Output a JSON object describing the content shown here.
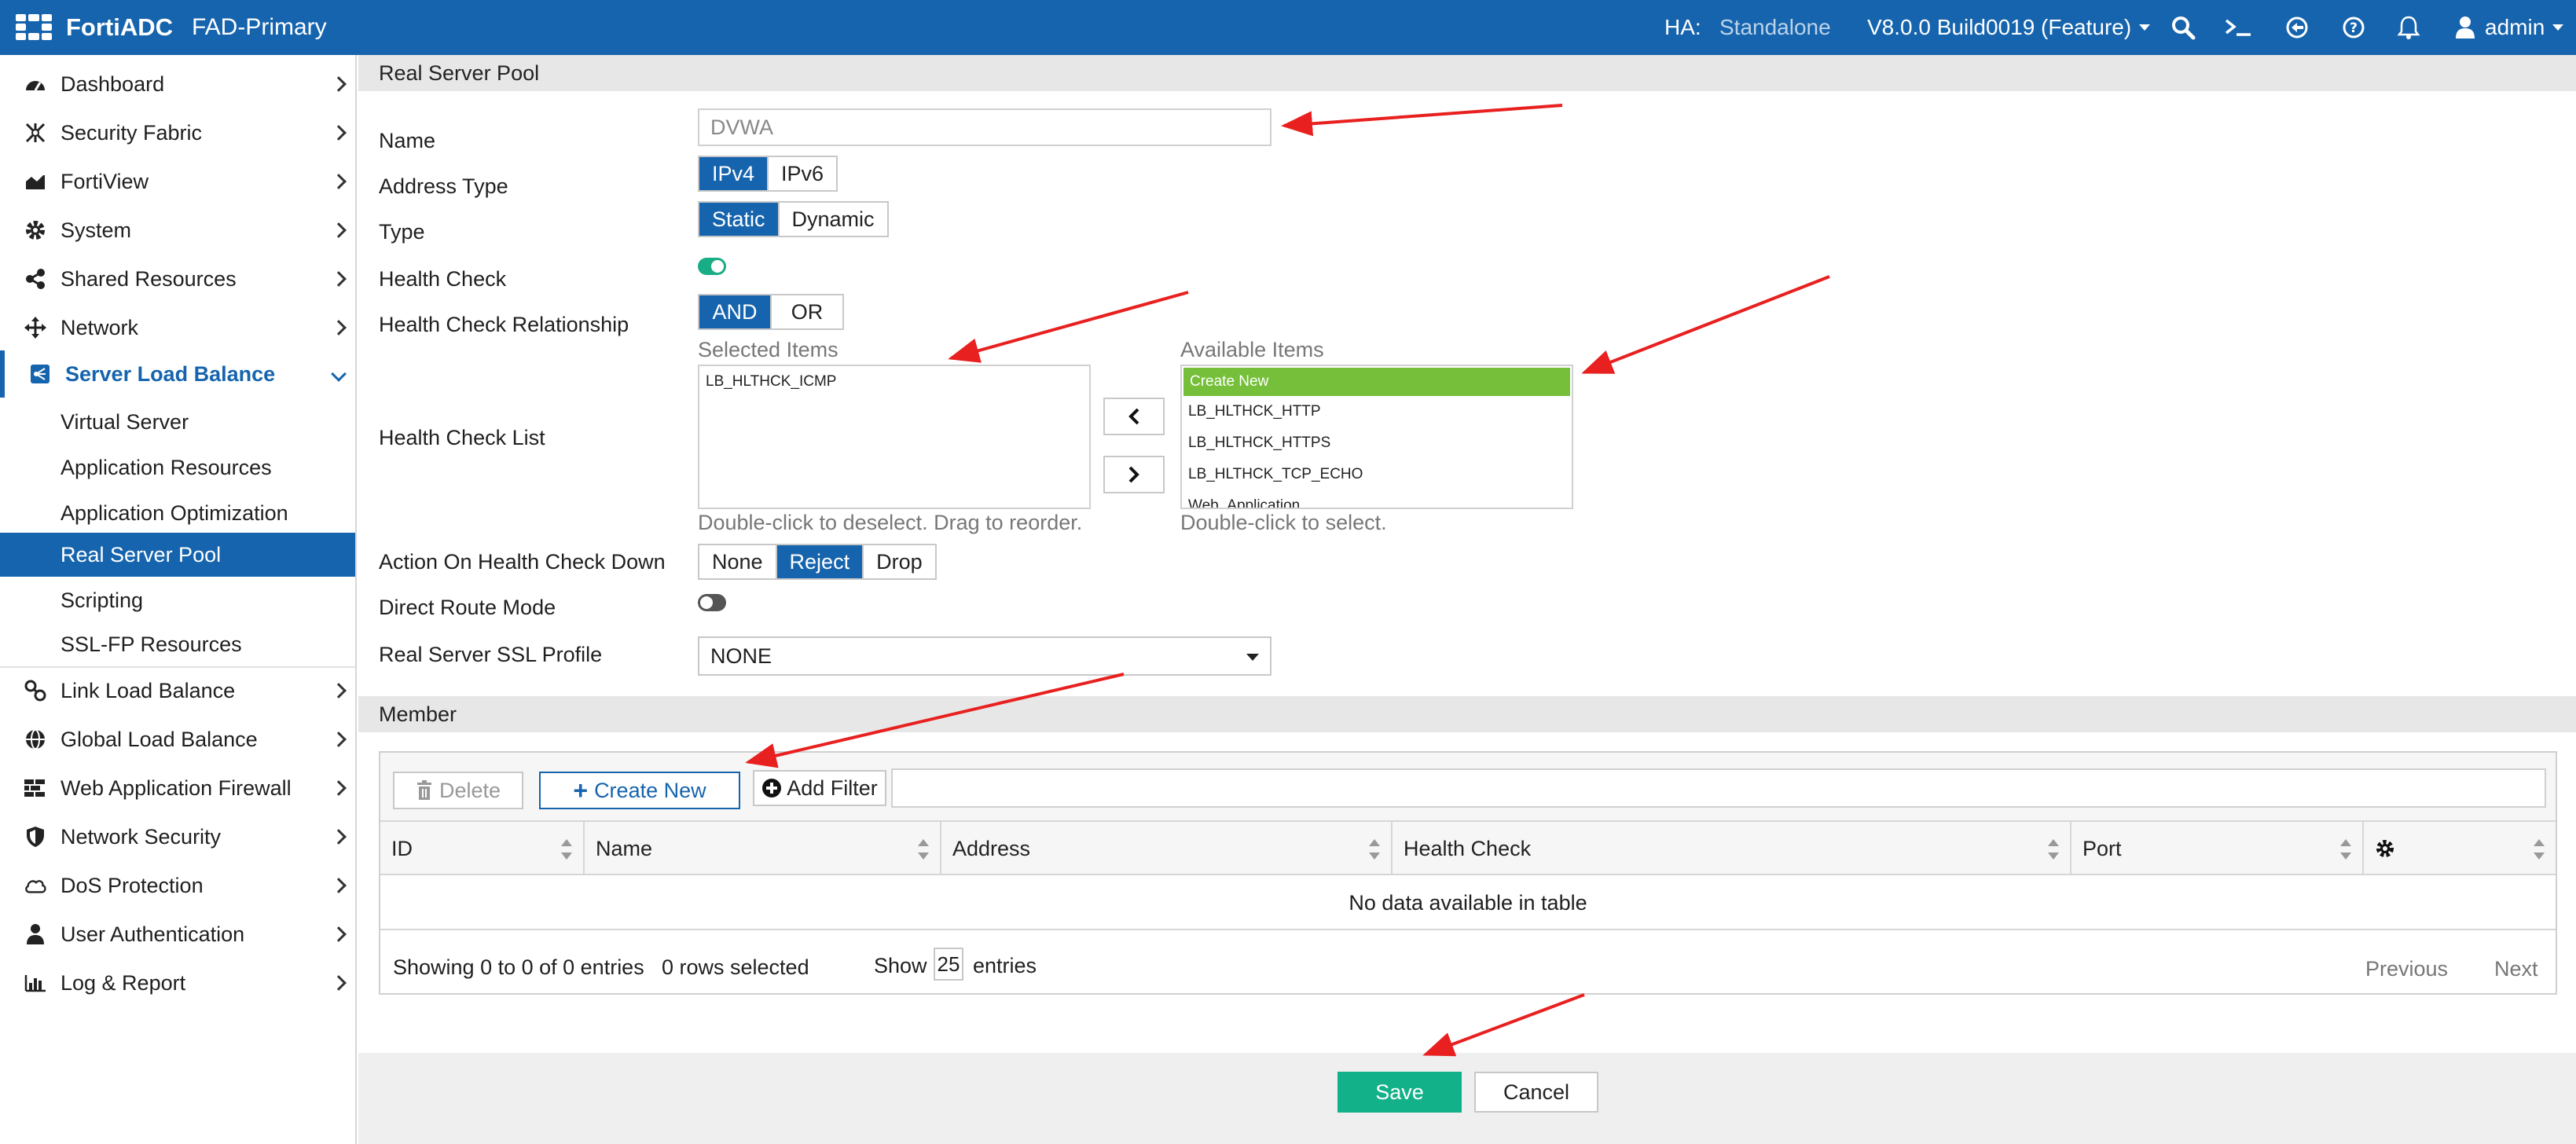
{
  "topbar": {
    "brand": "FortiADC",
    "hostname": "FAD-Primary",
    "ha_label": "HA:",
    "ha_value": "Standalone",
    "version": "V8.0.0 Build0019 (Feature)",
    "user": "admin",
    "icons": [
      "grid-icon",
      "search-icon",
      "terminal-icon",
      "refresh-icon",
      "help-icon",
      "bell-icon",
      "user-icon"
    ]
  },
  "sidebar": {
    "items": [
      {
        "label": "Dashboard",
        "icon": "dashboard-icon"
      },
      {
        "label": "Security Fabric",
        "icon": "fabric-icon"
      },
      {
        "label": "FortiView",
        "icon": "chart-icon"
      },
      {
        "label": "System",
        "icon": "gear-icon"
      },
      {
        "label": "Shared Resources",
        "icon": "share-icon"
      },
      {
        "label": "Network",
        "icon": "move-icon"
      },
      {
        "label": "Server Load Balance",
        "icon": "slb-icon"
      },
      {
        "label": "Link Load Balance",
        "icon": "link-icon"
      },
      {
        "label": "Global Load Balance",
        "icon": "globe-icon"
      },
      {
        "label": "Web Application Firewall",
        "icon": "firewall-icon"
      },
      {
        "label": "Network Security",
        "icon": "shield-icon"
      },
      {
        "label": "DoS Protection",
        "icon": "cloud-icon"
      },
      {
        "label": "User Authentication",
        "icon": "user-icon"
      },
      {
        "label": "Log & Report",
        "icon": "bar-chart-icon"
      }
    ],
    "subitems": [
      {
        "label": "Virtual Server"
      },
      {
        "label": "Application Resources"
      },
      {
        "label": "Application Optimization"
      },
      {
        "label": "Real Server Pool"
      },
      {
        "label": "Scripting"
      },
      {
        "label": "SSL-FP Resources"
      }
    ]
  },
  "form": {
    "section_title": "Real Server Pool",
    "name_label": "Name",
    "name_value": "DVWA",
    "address_type_label": "Address Type",
    "address_type_options": [
      "IPv4",
      "IPv6"
    ],
    "type_label": "Type",
    "type_options": [
      "Static",
      "Dynamic"
    ],
    "health_check_label": "Health Check",
    "relationship_label": "Health Check Relationship",
    "relationship_options": [
      "AND",
      "OR"
    ],
    "list_label": "Health Check List",
    "selected_caption": "Selected Items",
    "available_caption": "Available Items",
    "selected_items": [
      "LB_HLTHCK_ICMP"
    ],
    "available_items": [
      "Create New",
      "LB_HLTHCK_HTTP",
      "LB_HLTHCK_HTTPS",
      "LB_HLTHCK_TCP_ECHO",
      "Web_Application"
    ],
    "selected_hint": "Double-click to deselect. Drag to reorder.",
    "available_hint": "Double-click to select.",
    "action_label": "Action On Health Check Down",
    "action_options": [
      "None",
      "Reject",
      "Drop"
    ],
    "direct_route_label": "Direct Route Mode",
    "ssl_label": "Real Server SSL Profile",
    "ssl_value": "NONE"
  },
  "member": {
    "section_title": "Member",
    "delete_label": "Delete",
    "create_label": "Create New",
    "filter_label": "Add Filter",
    "columns": [
      "ID",
      "Name",
      "Address",
      "Health Check",
      "Port"
    ],
    "empty_text": "No data available in table",
    "showing_text": "Showing 0 to 0 of 0 entries",
    "rows_selected": "0 rows selected",
    "show_label": "Show",
    "page_size": "25",
    "entries_label": "entries",
    "prev_label": "Previous",
    "next_label": "Next"
  },
  "footer": {
    "save_label": "Save",
    "cancel_label": "Cancel"
  },
  "colors": {
    "brand_blue": "#1664ad",
    "toggle_green": "#19ad85",
    "create_new_green": "#75bf3a",
    "save_green": "#13b189",
    "annotation_red": "#e8201f"
  }
}
